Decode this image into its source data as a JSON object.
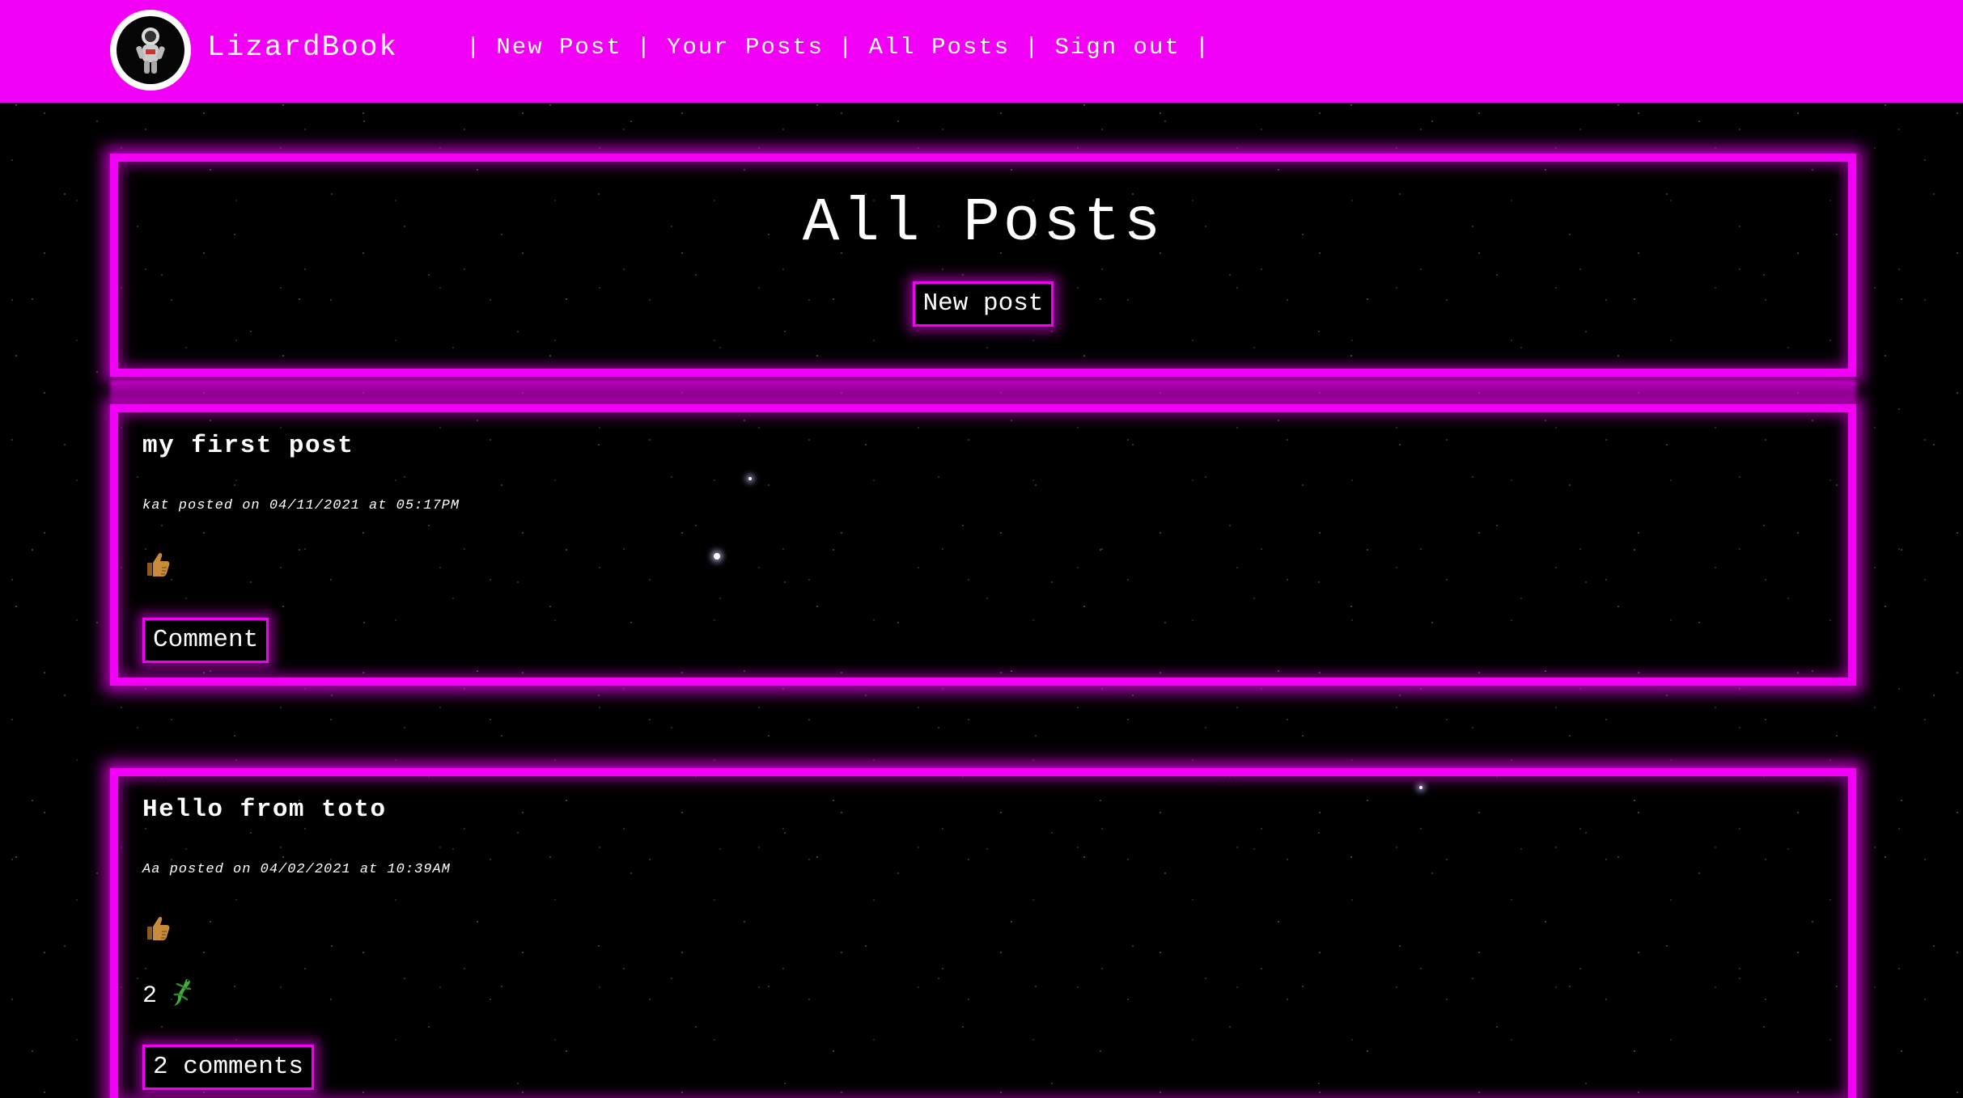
{
  "navbar": {
    "brand": "LizardBook",
    "links": [
      "New Post",
      "Your Posts",
      "All Posts",
      "Sign out"
    ],
    "separator": "|",
    "logo_icon": "astronaut-logo-icon",
    "background_color": "#f200f5"
  },
  "header": {
    "title": "All Posts",
    "new_post_button": "New post"
  },
  "posts": [
    {
      "title": "my first post",
      "meta": "kat posted on 04/11/2021 at 05:17PM",
      "like_icon": "thumbs-up-icon",
      "button": "Comment"
    },
    {
      "title": "Hello from toto",
      "meta": "Aa posted on 04/02/2021 at 10:39AM",
      "like_icon": "thumbs-up-icon",
      "lizard_count": "2",
      "lizard_icon": "lizard-icon",
      "button": "2 comments"
    }
  ],
  "theme": {
    "accent": "#f200f5",
    "background": "#000000",
    "text": "#ffffff"
  }
}
